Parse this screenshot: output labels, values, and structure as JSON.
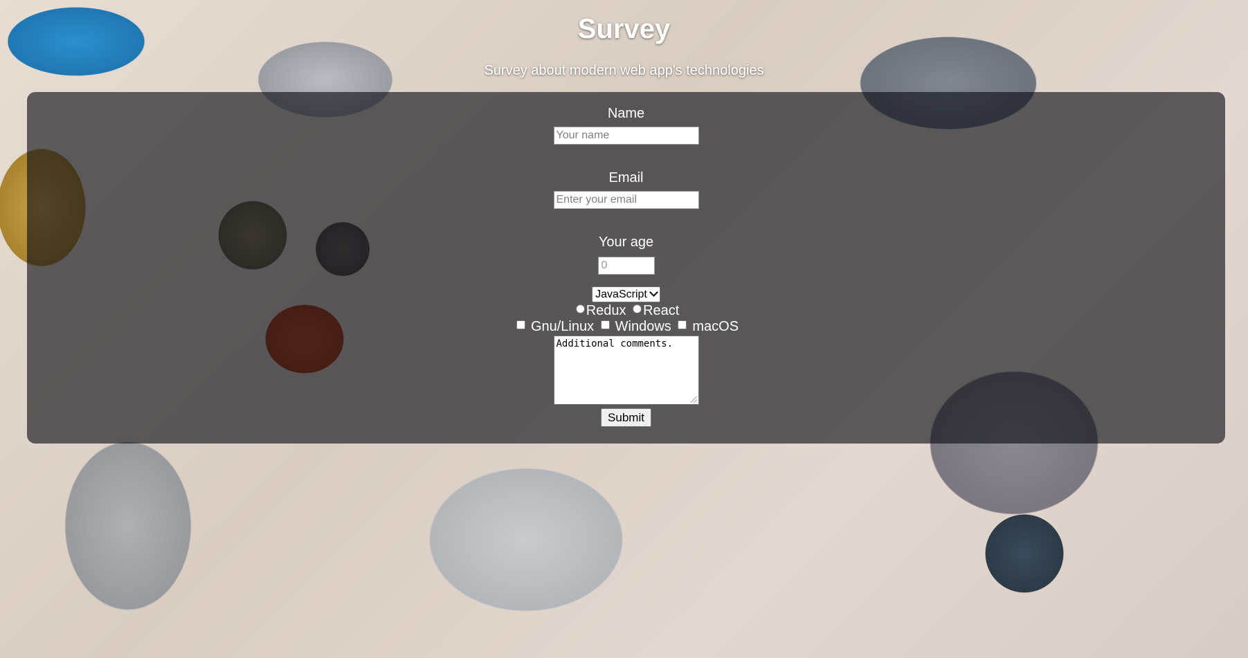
{
  "header": {
    "title": "Survey",
    "description": "Survey about modern web app's technologies"
  },
  "form": {
    "name_label": "Name",
    "name_placeholder": "Your name",
    "email_label": "Email",
    "email_placeholder": "Enter your email",
    "age_label": "Your age",
    "age_placeholder": "0",
    "language_select": {
      "selected": "JavaScript"
    },
    "radio_options": [
      "Redux",
      "React"
    ],
    "checkbox_options": [
      "Gnu/Linux",
      "Windows",
      "macOS"
    ],
    "comments_text": "Additional comments.",
    "submit_label": "Submit"
  },
  "theme": {
    "panel_overlay": "#0a0c14",
    "text_color": "#ffffff",
    "background_scene": "desk with laptops, headphones, coffee cups and phone"
  }
}
